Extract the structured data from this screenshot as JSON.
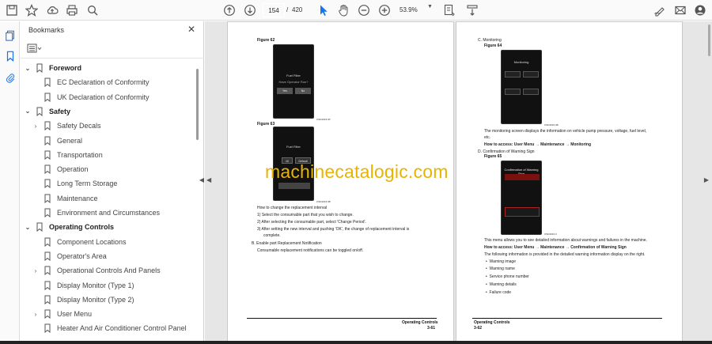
{
  "toolbar": {
    "current_page": "154",
    "separator": "/",
    "total_pages": "420",
    "zoom": "53.9%"
  },
  "bookmarks_panel": {
    "title": "Bookmarks",
    "items": [
      {
        "label": "Foreword",
        "level": 0,
        "expanded": true
      },
      {
        "label": "EC Declaration of Conformity",
        "level": 1
      },
      {
        "label": "UK Declaration of Conformity",
        "level": 1
      },
      {
        "label": "Safety",
        "level": 0,
        "expanded": true
      },
      {
        "label": "Safety Decals",
        "level": 1,
        "has_children": true
      },
      {
        "label": "General",
        "level": 1
      },
      {
        "label": "Transportation",
        "level": 1
      },
      {
        "label": "Operation",
        "level": 1
      },
      {
        "label": "Long Term Storage",
        "level": 1
      },
      {
        "label": "Maintenance",
        "level": 1
      },
      {
        "label": "Environment and Circumstances",
        "level": 1
      },
      {
        "label": "Operating Controls",
        "level": 0,
        "expanded": true
      },
      {
        "label": "Component Locations",
        "level": 1
      },
      {
        "label": "Operator's Area",
        "level": 1
      },
      {
        "label": "Operational Controls And Panels",
        "level": 1,
        "has_children": true
      },
      {
        "label": "Display Monitor (Type 1)",
        "level": 1
      },
      {
        "label": "Display Monitor (Type 2)",
        "level": 1
      },
      {
        "label": "User Menu",
        "level": 1,
        "has_children": true
      },
      {
        "label": "Heater And Air Conditioner Control Panel",
        "level": 1
      }
    ]
  },
  "left_page": {
    "fig62_label": "Figure 62",
    "fig62_title": "Fuel Filter",
    "fig62_question": "Have Operator Run?",
    "fig62_yes": "Yes",
    "fig62_no": "No",
    "fig62_code": "OSD1919 0P",
    "fig63_label": "Figure 63",
    "fig63_title": "Fuel Filter",
    "fig63_btn1": "10",
    "fig63_btn2": "Default",
    "fig63_code": "OSD1919 0B",
    "how_to": "How to change the replacement interval",
    "step1": "1)  Select the consumable part that you wish to change.",
    "step2": "2)  After selecting the consumable part, select 'Change Period'.",
    "step3a": "3)  After setting the new interval and pushing 'OK', the change of replacement interval is",
    "step3b": "complete.",
    "step_b": "B.  Enable part Replacement Notification",
    "notif": "Consumable replacement notifications can be toggled on/off.",
    "footer_title": "Operating Controls",
    "footer_page": "3-61"
  },
  "right_page": {
    "section_c": "C.  Monitoring",
    "fig64_label": "Figure 64",
    "fig64_title": "Monitoring",
    "fig64_code": "OSD1919 0B",
    "monitor_desc1": "The monitoring screen displays the information on vehicle pump pressure, voltage, fuel level,",
    "monitor_desc2": "etc.",
    "access1": "How to access: User Menu → Maintenance → Monitoring",
    "section_d": "D.  Confirmation of Warning Sign",
    "fig65_label": "Figure 65",
    "fig65_title": "Confirmation of Warning Sign",
    "fig65_code": "OSD1919 0",
    "warn_desc": "This menu allows you to see detailed information about warnings and failures in the machine.",
    "access2": "How to access: User Menu → Maintenance → Confirmation of Warning Sign",
    "list_intro": "The following information is provided in the detailed warning information display on the right.",
    "bullets": [
      "Warning image",
      "Warning name",
      "Service phone number",
      "Warning details",
      "Failure code"
    ],
    "footer_title": "Operating Controls",
    "footer_page": "3-62"
  },
  "watermark": "machinecatalogic.com",
  "icons": {
    "save": "save-icon",
    "bookmark_star": "star-icon",
    "upload": "upload-icon",
    "print": "print-icon",
    "search": "search-icon",
    "prev_page": "page-up-icon",
    "next_page": "page-down-icon",
    "select": "cursor-icon",
    "hand": "hand-icon",
    "zoom_out": "zoom-out-icon",
    "zoom_in": "zoom-in-icon"
  }
}
